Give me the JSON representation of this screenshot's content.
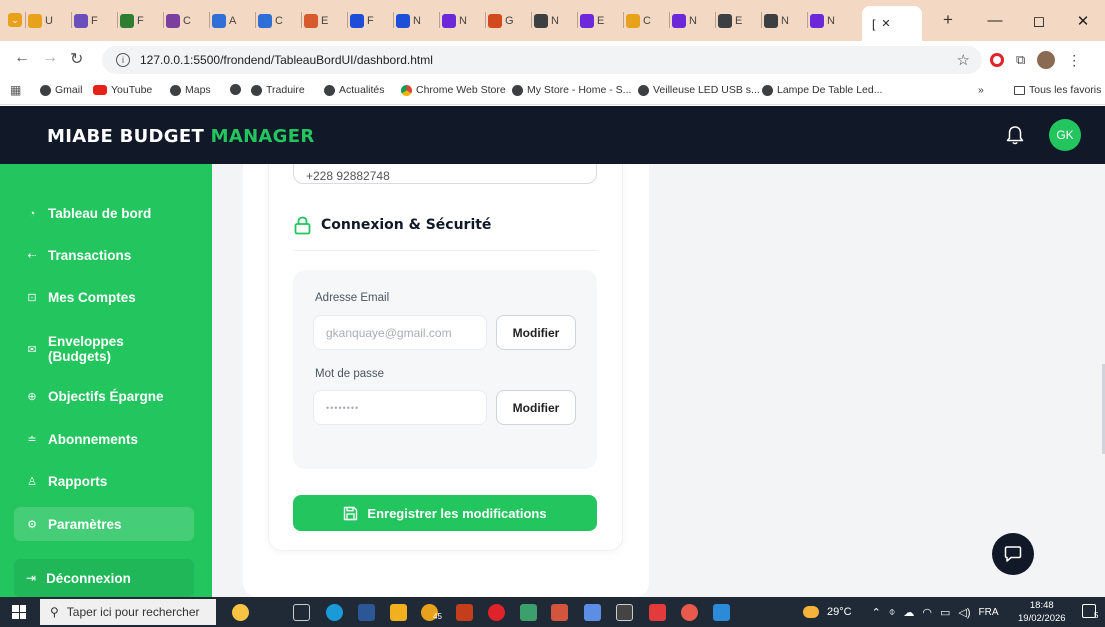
{
  "browser": {
    "tabs": [
      {
        "label": "U"
      },
      {
        "label": "F"
      },
      {
        "label": "F"
      },
      {
        "label": "C"
      },
      {
        "label": "A"
      },
      {
        "label": "C"
      },
      {
        "label": "E"
      },
      {
        "label": "F"
      },
      {
        "label": "N"
      },
      {
        "label": "N"
      },
      {
        "label": "G"
      },
      {
        "label": "N"
      },
      {
        "label": "E"
      },
      {
        "label": "C"
      },
      {
        "label": "N"
      },
      {
        "label": "E"
      },
      {
        "label": "N"
      },
      {
        "label": "N"
      }
    ],
    "active_tab_label": "[",
    "url": "127.0.0.1:5500/frondend/TableauBordUI/dashbord.html",
    "new_tab": "+",
    "window_controls": [
      "—",
      "◻",
      "✕"
    ]
  },
  "bookmarks": {
    "items": [
      "Gmail",
      "YouTube",
      "Maps",
      "",
      "Traduire",
      "Actualités",
      "Chrome Web Store",
      "My Store - Home - S...",
      "Veilleuse LED USB s...",
      "Lampe De Table Led..."
    ],
    "more": "»",
    "all_favorites": "Tous les favoris"
  },
  "app": {
    "brand_part1": "MIABE BUDGET ",
    "brand_part2": "MANAGER",
    "avatar_initials": "GK",
    "accent_color": "#22c55e",
    "header_bg": "#111827"
  },
  "sidebar": {
    "items": [
      {
        "label": "Tableau de bord",
        "icon": "dashboard-icon"
      },
      {
        "label": "Transactions",
        "icon": "exchange-icon"
      },
      {
        "label": "Mes Comptes",
        "icon": "wallet-icon"
      },
      {
        "label": "Enveloppes (Budgets)",
        "icon": "envelope-icon"
      },
      {
        "label": "Objectifs Épargne",
        "icon": "target-icon"
      },
      {
        "label": "Abonnements",
        "icon": "subscription-icon"
      },
      {
        "label": "Rapports",
        "icon": "report-icon"
      },
      {
        "label": "Paramètres",
        "icon": "settings-icon",
        "active": true
      }
    ],
    "logout_label": "Déconnexion"
  },
  "settings": {
    "phone_value": "+228 92882748",
    "security_title": "Connexion & Sécurité",
    "email_label": "Adresse Email",
    "email_value": "gkanquaye@gmail.com",
    "email_button": "Modifier",
    "password_label": "Mot de passe",
    "password_value": "••••••••",
    "password_button": "Modifier",
    "save_label": "Enregistrer les modifications"
  },
  "taskbar": {
    "search_placeholder": "Taper ici pour rechercher",
    "badge_count": "45",
    "weather": "29°C",
    "language": "FRA",
    "time": "18:48",
    "date": "19/02/2026",
    "notifications": "5"
  }
}
